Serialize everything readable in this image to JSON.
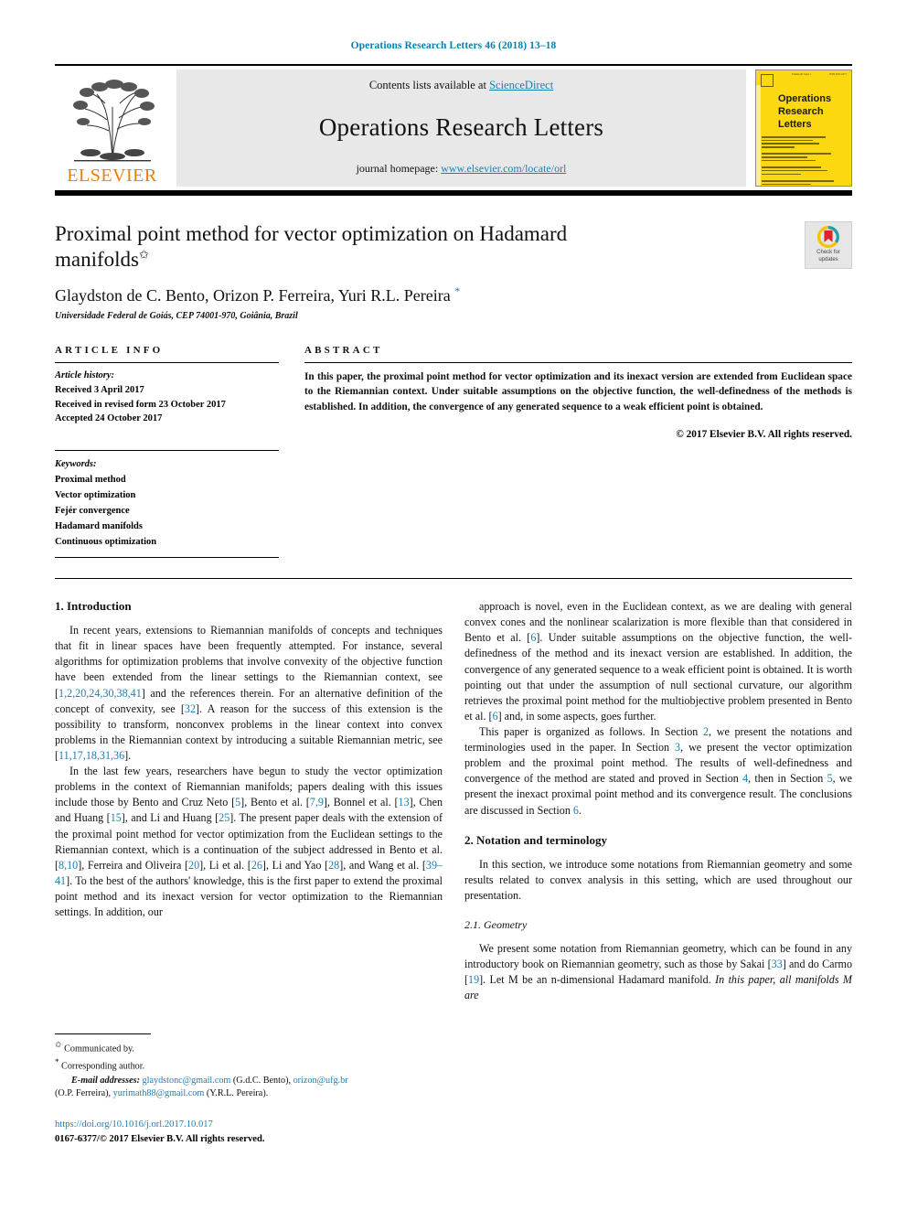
{
  "running_head": "Operations Research Letters 46 (2018) 13–18",
  "masthead": {
    "contents_prefix": "Contents lists available at ",
    "sciencedirect": "ScienceDirect",
    "journal_name": "Operations Research Letters",
    "homepage_prefix": "journal homepage: ",
    "homepage_url": "www.elsevier.com/locate/orl",
    "publisher_logo_text": "ELSEVIER",
    "cover": {
      "title_line1": "Operations",
      "title_line2": "Research",
      "title_line3": "Letters",
      "bg_color": "#fbd80f"
    }
  },
  "article": {
    "title": "Proximal point method for vector optimization on Hadamard manifolds",
    "title_footnote_mark": "✩",
    "authors": "Glaydston de C. Bento, Orizon P. Ferreira, Yuri R.L. Pereira",
    "corresponding_mark": "*",
    "affiliation": "Universidade Federal de Goiás, CEP 74001-970, Goiânia, Brazil",
    "crossmark_label_line1": "Check for",
    "crossmark_label_line2": "updates"
  },
  "article_info": {
    "heading": "ARTICLE INFO",
    "history_title": "Article history:",
    "history": [
      "Received 3 April 2017",
      "Received in revised form 23 October 2017",
      "Accepted 24 October 2017"
    ],
    "keywords_title": "Keywords:",
    "keywords": [
      "Proximal method",
      "Vector optimization",
      "Fejér convergence",
      "Hadamard manifolds",
      "Continuous optimization"
    ]
  },
  "abstract": {
    "heading": "ABSTRACT",
    "text": "In this paper, the proximal point method for vector optimization and its inexact version are extended from Euclidean space to the Riemannian context. Under suitable assumptions on the objective function, the well-definedness of the methods is established. In addition, the convergence of any generated sequence to a weak efficient point is obtained.",
    "copyright": "© 2017 Elsevier B.V. All rights reserved."
  },
  "sections": {
    "intro_heading": "1. Introduction",
    "notation_heading": "2. Notation and terminology",
    "geometry_heading": "2.1. Geometry"
  },
  "body": {
    "left": {
      "p1_a": "In recent years, extensions to Riemannian manifolds of concepts and techniques that fit in linear spaces have been frequently attempted. For instance, several algorithms for optimization problems that involve convexity of the objective function have been extended from the linear settings to the Riemannian context, see [",
      "p1_refs1": "1,2,20,24,30,38,41",
      "p1_b": "] and the references therein. For an alternative definition of the concept of convexity, see [",
      "p1_refs2": "32",
      "p1_c": "]. A reason for the success of this extension is the possibility to transform, nonconvex problems in the linear context into convex problems in the Riemannian context by introducing a suitable Riemannian metric, see [",
      "p1_refs3": "11,17,18,31,36",
      "p1_d": "].",
      "p2_a": "In the last few years, researchers have begun to study the vector optimization problems in the context of Riemannian manifolds; papers dealing with this issues include those by Bento and Cruz Neto [",
      "p2_r1": "5",
      "p2_b": "], Bento et al. [",
      "p2_r2": "7,9",
      "p2_c": "], Bonnel et al. [",
      "p2_r3": "13",
      "p2_d": "], Chen and Huang [",
      "p2_r4": "15",
      "p2_e": "], and Li and Huang [",
      "p2_r5": "25",
      "p2_f": "]. The present paper deals with the extension of the proximal point method for vector optimization from the Euclidean settings to the Riemannian context, which is a continuation of the subject addressed in Bento et al. [",
      "p2_r6": "8,10",
      "p2_g": "], Ferreira and Oliveira [",
      "p2_r7": "20",
      "p2_h": "], Li et al. [",
      "p2_r8": "26",
      "p2_i": "], Li and Yao [",
      "p2_r9": "28",
      "p2_j": "], and Wang et al. [",
      "p2_r10": "39–41",
      "p2_k": "]. To the best of the authors' knowledge, this is the first paper to extend the proximal point method and its inexact version for vector optimization to the Riemannian settings. In addition, our"
    },
    "right": {
      "p3_a": "approach is novel, even in the Euclidean context, as we are dealing with general convex cones and the nonlinear scalarization is more flexible than that considered in Bento et al. [",
      "p3_r1": "6",
      "p3_b": "]. Under suitable assumptions on the objective function, the well-definedness of the method and its inexact version are established. In addition, the convergence of any generated sequence to a weak efficient point is obtained. It is worth pointing out that under the assumption of null sectional curvature, our algorithm retrieves the proximal point method for the multiobjective problem presented in Bento et al. [",
      "p3_r2": "6",
      "p3_c": "] and, in some aspects, goes further.",
      "p4_a": "This paper is organized as follows. In Section ",
      "p4_r1": "2",
      "p4_b": ", we present the notations and terminologies used in the paper. In Section ",
      "p4_r2": "3",
      "p4_c": ", we present the vector optimization problem and the proximal point method. The results of well-definedness and convergence of the method are stated and proved in Section ",
      "p4_r3": "4",
      "p4_d": ", then in Section ",
      "p4_r4": "5",
      "p4_e": ", we present the inexact proximal point method and its convergence result. The conclusions are discussed in Section ",
      "p4_r5": "6",
      "p4_f": ".",
      "p5": "In this section, we introduce some notations from Riemannian geometry and some results related to convex analysis in this setting, which are used throughout our presentation.",
      "p6_a": "We present some notation from Riemannian geometry, which can be found in any introductory book on Riemannian geometry, such as those by Sakai [",
      "p6_r1": "33",
      "p6_b": "] and do Carmo [",
      "p6_r2": "19",
      "p6_c": "]. Let M be an n-dimensional Hadamard manifold. ",
      "p6_italic": "In this paper, all manifolds M are"
    }
  },
  "footnotes": {
    "communicated_mark": "✩",
    "communicated": "Communicated by.",
    "corresponding_mark": "*",
    "corresponding": "Corresponding author.",
    "email_label": "E-mail addresses:",
    "email1": "glaydstonc@gmail.com",
    "email1_name": "(G.d.C. Bento),",
    "email2": "orizon@ufg.br",
    "email2_name": "(O.P. Ferreira),",
    "email3": "yurimath88@gmail.com",
    "email3_name": "(Y.R.L. Pereira).",
    "doi": "https://doi.org/10.1016/j.orl.2017.10.017",
    "issn_line": "0167-6377/© 2017 Elsevier B.V. All rights reserved."
  },
  "colors": {
    "link": "#1a7fb5",
    "elsevier_orange": "#ef7d00",
    "cover_yellow": "#fbd80f"
  }
}
